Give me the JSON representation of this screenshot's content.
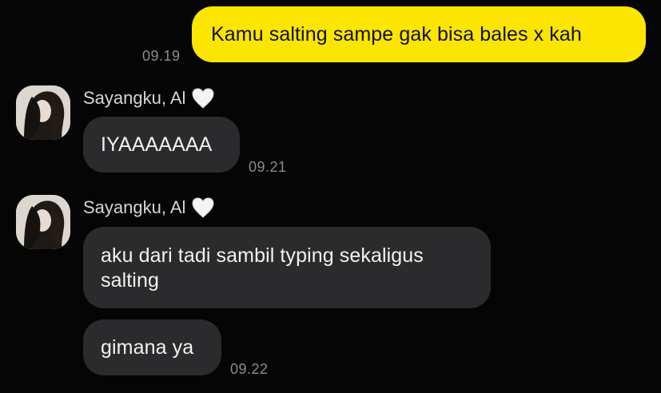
{
  "chat": {
    "messages": [
      {
        "sender": "me",
        "text": "Kamu salting sampe gak bisa bales x kah",
        "time": "09.19"
      }
    ],
    "groups": [
      {
        "sender_name": "Sayangku, Al",
        "sender_emoji": "heart-icon",
        "messages": [
          {
            "text": "IYAAAAAAA",
            "time": "09.21"
          }
        ]
      },
      {
        "sender_name": "Sayangku, Al",
        "sender_emoji": "heart-icon",
        "messages": [
          {
            "text": "aku dari tadi sambil typing sekaligus salting"
          },
          {
            "text": "gimana ya",
            "time": "09.22"
          }
        ]
      }
    ]
  },
  "colors": {
    "background": "#050505",
    "outgoing_bubble": "#fce500",
    "incoming_bubble": "#2b2b2d",
    "timestamp": "#8c8c8c"
  }
}
